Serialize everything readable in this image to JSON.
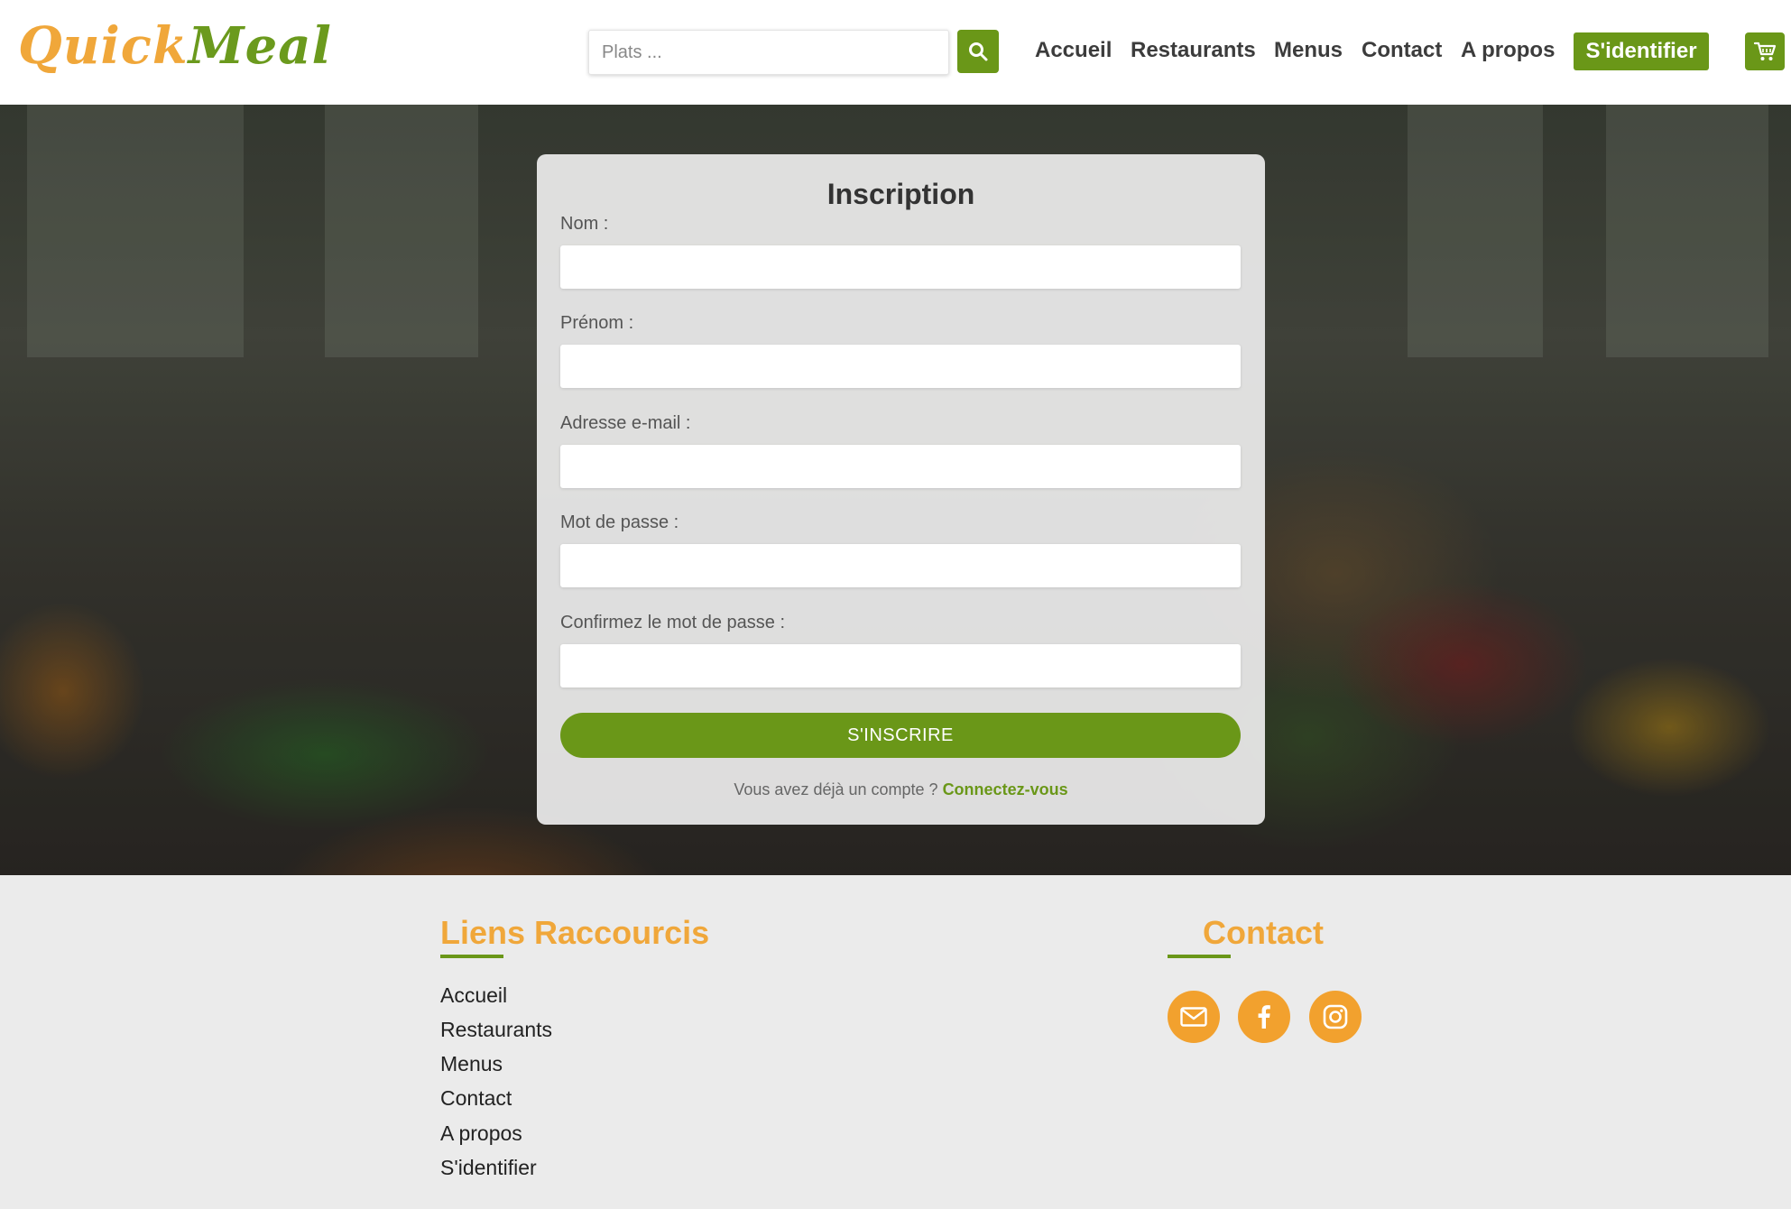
{
  "header": {
    "logo_quick": "Quick",
    "logo_meal": "Meal",
    "search_placeholder": "Plats ...",
    "nav": [
      "Accueil",
      "Restaurants",
      "Menus",
      "Contact",
      "A propos"
    ],
    "login_label": "S'identifier"
  },
  "form": {
    "title": "Inscription",
    "fields": [
      {
        "label": "Nom :",
        "value": ""
      },
      {
        "label": "Prénom :",
        "value": ""
      },
      {
        "label": "Adresse e-mail :",
        "value": ""
      },
      {
        "label": "Mot de passe :",
        "value": ""
      },
      {
        "label": "Confirmez le mot de passe :",
        "value": ""
      }
    ],
    "submit_label": "S'INSCRIRE",
    "login_prompt": "Vous avez déjà un compte ?",
    "login_link": "Connectez-vous"
  },
  "footer": {
    "links_title": "Liens Raccourcis",
    "links": [
      "Accueil",
      "Restaurants",
      "Menus",
      "Contact",
      "A propos",
      "S'identifier"
    ],
    "contact_title": "Contact",
    "socials": [
      "mail-icon",
      "facebook-icon",
      "instagram-icon"
    ]
  },
  "colors": {
    "brand_green": "#6a9718",
    "brand_orange": "#f0a73a",
    "footer_bg": "#ebebeb"
  }
}
